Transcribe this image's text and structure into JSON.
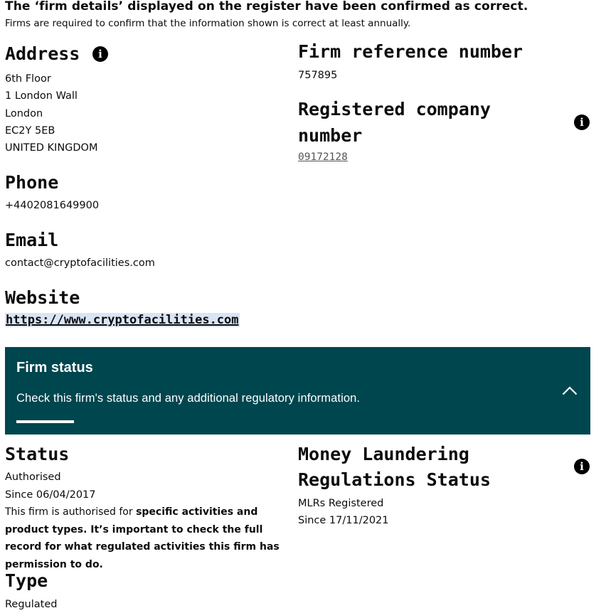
{
  "confirmation": {
    "title": "The ‘firm details’ displayed on the register have been confirmed as correct.",
    "subtitle": "Firms are required to confirm that the information shown is correct at least annually."
  },
  "address": {
    "heading": "Address",
    "lines": [
      "6th Floor",
      "1 London Wall",
      "London",
      "EC2Y 5EB",
      "UNITED KINGDOM"
    ]
  },
  "firm_reference": {
    "heading": "Firm reference number",
    "value": "757895"
  },
  "company_number": {
    "heading_line1": "Registered company",
    "heading_line2": "number",
    "value": "09172128"
  },
  "phone": {
    "heading": "Phone",
    "value": "+4402081649900"
  },
  "email": {
    "heading": "Email",
    "value": "contact@cryptofacilities.com"
  },
  "website": {
    "heading": "Website",
    "value": "https://www.cryptofacilities.com"
  },
  "firm_status_panel": {
    "title": "Firm status",
    "subtitle": "Check this firm's status and any additional regulatory information.",
    "expanded": true,
    "background": "#00464f"
  },
  "status": {
    "heading": "Status",
    "value": "Authorised",
    "since": "Since 06/04/2017",
    "note_plain": "This firm is authorised for ",
    "note_bold": "specific activities and product types. It’s important to check the full record for what regulated activities this firm has permission to do."
  },
  "mlr_status": {
    "heading_line1": "Money Laundering",
    "heading_line2": "Regulations Status",
    "value": "MLRs Registered",
    "since": "Since 17/11/2021"
  },
  "type": {
    "heading": "Type",
    "value": "Regulated"
  },
  "icons": {
    "info": "i"
  }
}
